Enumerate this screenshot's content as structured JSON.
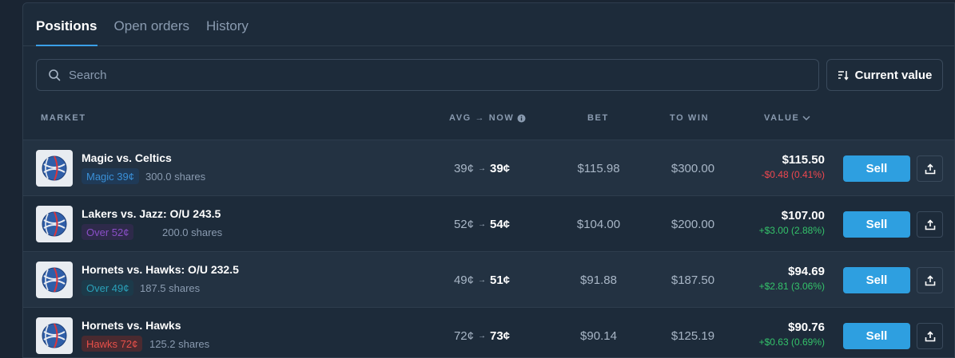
{
  "tabs": [
    {
      "label": "Positions",
      "active": true
    },
    {
      "label": "Open orders",
      "active": false
    },
    {
      "label": "History",
      "active": false
    }
  ],
  "search": {
    "placeholder": "Search",
    "icon": "search-icon"
  },
  "sort": {
    "label": "Current value",
    "icon": "sort-icon"
  },
  "columns": {
    "market": "MARKET",
    "avg_now": "AVG → NOW",
    "bet": "BET",
    "to_win": "TO WIN",
    "value": "VALUE"
  },
  "colors": {
    "accent": "#2e9fe0",
    "positive": "#34c26a",
    "negative": "#f0474f"
  },
  "rows": [
    {
      "title": "Magic vs. Celtics",
      "tag": "Magic 39¢",
      "tag_fg": "#3a8fd6",
      "tag_bg": "#1f3a57",
      "shares": "300.0 shares",
      "avg": "39¢",
      "now": "39¢",
      "bet": "$115.98",
      "to_win": "$300.00",
      "value": "$115.50",
      "change": "-$0.48 (0.41%)",
      "change_dir": "neg",
      "sell": "Sell"
    },
    {
      "title": "Lakers vs. Jazz: O/U 243.5",
      "tag": "Over 52¢",
      "tag_fg": "#8a4fc7",
      "tag_bg": "#2e2a4a",
      "shares": "200.0 shares",
      "avg": "52¢",
      "now": "54¢",
      "bet": "$104.00",
      "to_win": "$200.00",
      "value": "$107.00",
      "change": "+$3.00 (2.88%)",
      "change_dir": "pos",
      "sell": "Sell"
    },
    {
      "title": "Hornets vs. Hawks: O/U 232.5",
      "tag": "Over 49¢",
      "tag_fg": "#2aa0b8",
      "tag_bg": "#1c3a4a",
      "shares": "187.5 shares",
      "avg": "49¢",
      "now": "51¢",
      "bet": "$91.88",
      "to_win": "$187.50",
      "value": "$94.69",
      "change": "+$2.81 (3.06%)",
      "change_dir": "pos",
      "sell": "Sell"
    },
    {
      "title": "Hornets vs. Hawks",
      "tag": "Hawks 72¢",
      "tag_fg": "#e8504a",
      "tag_bg": "#4a2a30",
      "shares": "125.2 shares",
      "avg": "72¢",
      "now": "73¢",
      "bet": "$90.14",
      "to_win": "$125.19",
      "value": "$90.76",
      "change": "+$0.63 (0.69%)",
      "change_dir": "pos",
      "sell": "Sell"
    }
  ]
}
